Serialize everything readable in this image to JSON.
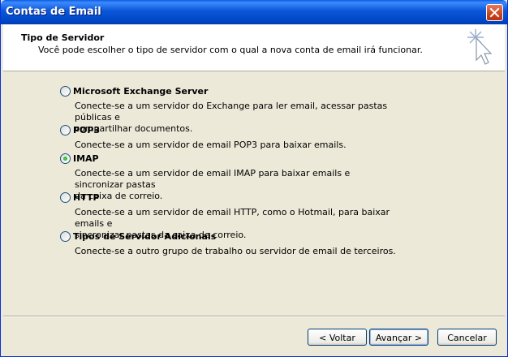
{
  "window": {
    "title": "Contas de Email"
  },
  "header": {
    "title": "Tipo de Servidor",
    "description": "Você pode escolher o tipo de servidor com o qual a nova conta de email irá funcionar."
  },
  "options": [
    {
      "label": "Microsoft Exchange Server",
      "desc_line1": "Conecte-se a um servidor do Exchange para ler email, acessar pastas públicas e",
      "desc_line2": "compartilhar documentos.",
      "selected": false
    },
    {
      "label": "POP3",
      "desc_line1": "Conecte-se a um servidor de email POP3 para baixar emails.",
      "desc_line2": "",
      "selected": false
    },
    {
      "label": "IMAP",
      "desc_line1": "Conecte-se a um servidor de email IMAP para baixar emails e sincronizar pastas",
      "desc_line2": "da caixa de correio.",
      "selected": true
    },
    {
      "label": "HTTP",
      "desc_line1": "Conecte-se a um servidor de email HTTP, como o Hotmail, para baixar emails e",
      "desc_line2": "sincronizar pastas da caixa de correio.",
      "selected": false
    },
    {
      "label": "Tipos de Servidor Adicionais",
      "desc_line1": "Conecte-se a outro grupo de trabalho ou servidor de email de terceiros.",
      "desc_line2": "",
      "selected": false
    }
  ],
  "buttons": {
    "back": "< Voltar",
    "next": "Avançar >",
    "cancel": "Cancelar"
  }
}
